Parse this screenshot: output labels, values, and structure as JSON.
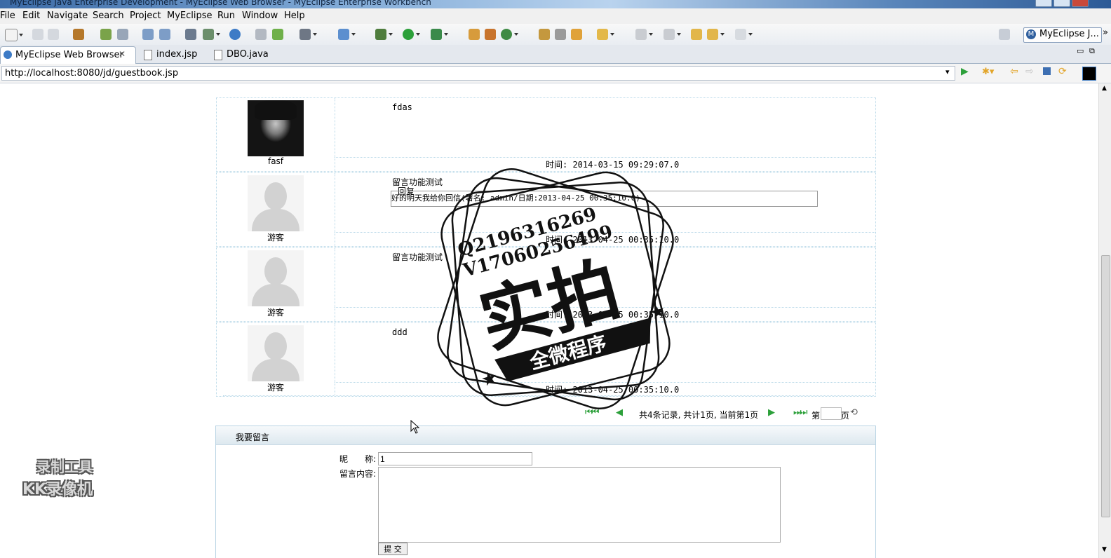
{
  "window": {
    "title": "MyEclipse Java Enterprise Development - MyEclipse Web Browser - MyEclipse Enterprise Workbench"
  },
  "menu": [
    "File",
    "Edit",
    "Navigate",
    "Search",
    "Project",
    "MyEclipse",
    "Run",
    "Window",
    "Help"
  ],
  "perspective": {
    "label": "MyEclipse J..."
  },
  "tabs": [
    {
      "label": "MyEclipse Web Browser",
      "active": true
    },
    {
      "label": "index.jsp",
      "active": false
    },
    {
      "label": "DBO.java",
      "active": false
    }
  ],
  "browser": {
    "url": "http://localhost:8080/jd/guestbook.jsp"
  },
  "messages": [
    {
      "nickname": "fasf",
      "content": "fdas",
      "time": "时间: 2014-03-15 09:29:07.0",
      "avatar": "photo"
    },
    {
      "nickname": "游客",
      "content": "留言功能测试",
      "reply_label": "回复",
      "reply_text": "好的明天我给你回信(署名: admin/日期:2013-04-25 00:35:10.0)",
      "time": "时间: 2013-04-25 00:35:10.0",
      "avatar": "default"
    },
    {
      "nickname": "游客",
      "content": "留言功能测试",
      "time": "时间: 2013-04-25 00:35:10.0",
      "avatar": "default"
    },
    {
      "nickname": "游客",
      "content": "ddd",
      "time": "时间: 2013-04-25 00:35:10.0",
      "avatar": "default"
    }
  ],
  "pagination": {
    "summary": "共4条记录, 共计1页, 当前第1页",
    "page_prefix": "第",
    "page_suffix": "页",
    "page_value": ""
  },
  "form": {
    "header": "我要留言",
    "nickname_label": "昵　　称:",
    "nickname_value": "1",
    "content_label": "留言内容:",
    "content_value": "",
    "submit_label": "提 交"
  },
  "stamp": {
    "line1": "Q2196316269",
    "line2": "V17060256499",
    "main": "实拍",
    "banner": "全微程序"
  },
  "recorder_watermark": {
    "line1": "录制工具",
    "line2": "KK录像机"
  }
}
